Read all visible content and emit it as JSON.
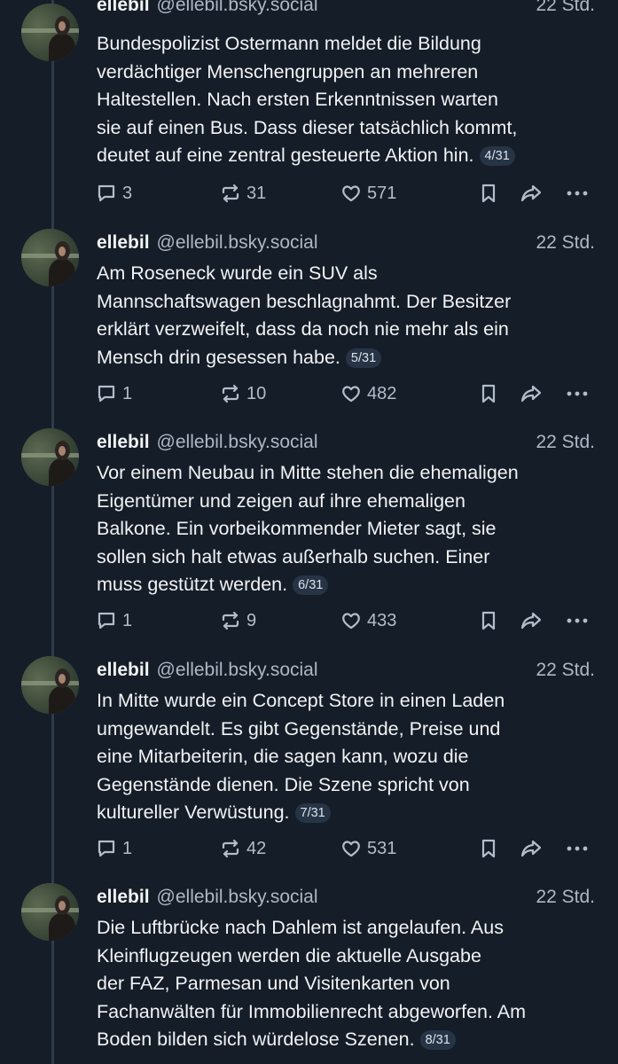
{
  "posts": [
    {
      "author": "ellebil",
      "handle": "@ellebil.bsky.social",
      "time": "22 Std.",
      "lines": [
        "Bundespolizist Ostermann meldet die Bildung",
        "verdächtiger Menschengruppen an mehreren",
        "Haltestellen. Nach ersten Erkenntnissen warten",
        "sie auf einen Bus. Dass dieser tatsächlich kommt,",
        "deutet auf eine zentral gesteuerte Aktion hin."
      ],
      "badge": "4/31",
      "replies": "3",
      "reposts": "31",
      "likes": "571"
    },
    {
      "author": "ellebil",
      "handle": "@ellebil.bsky.social",
      "time": "22 Std.",
      "lines": [
        "Am Roseneck wurde ein SUV als",
        "Mannschaftswagen beschlagnahmt. Der Besitzer",
        "erklärt verzweifelt, dass da noch nie mehr als ein",
        "Mensch drin gesessen habe."
      ],
      "badge": "5/31",
      "replies": "1",
      "reposts": "10",
      "likes": "482"
    },
    {
      "author": "ellebil",
      "handle": "@ellebil.bsky.social",
      "time": "22 Std.",
      "lines": [
        "Vor einem Neubau in Mitte stehen die ehemaligen",
        "Eigentümer und zeigen auf ihre ehemaligen",
        "Balkone. Ein vorbeikommender Mieter sagt, sie",
        "sollen sich halt etwas außerhalb suchen. Einer",
        "muss gestützt werden."
      ],
      "badge": "6/31",
      "replies": "1",
      "reposts": "9",
      "likes": "433"
    },
    {
      "author": "ellebil",
      "handle": "@ellebil.bsky.social",
      "time": "22 Std.",
      "lines": [
        "In Mitte wurde ein Concept Store in einen Laden",
        "umgewandelt. Es gibt Gegenstände, Preise und",
        "eine Mitarbeiterin, die sagen kann, wozu die",
        "Gegenstände dienen. Die Szene spricht von",
        "kultureller Verwüstung."
      ],
      "badge": "7/31",
      "replies": "1",
      "reposts": "42",
      "likes": "531"
    },
    {
      "author": "ellebil",
      "handle": "@ellebil.bsky.social",
      "time": "22 Std.",
      "lines": [
        "Die Luftbrücke nach Dahlem ist angelaufen. Aus",
        "Kleinflugzeugen werden die aktuelle Ausgabe",
        "der FAZ, Parmesan und Visitenkarten von",
        "Fachanwälten für Immobilienrecht abgeworfen. Am",
        "Boden bilden sich würdelose Szenen."
      ],
      "badge": "8/31"
    }
  ],
  "icons": {
    "reply": "reply-icon",
    "repost": "repost-icon",
    "like": "heart-icon",
    "bookmark": "bookmark-icon",
    "share": "share-icon",
    "more": "more-icon"
  },
  "colors": {
    "background": "#151d28",
    "text": "#f1f3f5",
    "muted": "#aeb8c4",
    "badge_bg": "#263446",
    "thread_line": "#2e3b4c"
  }
}
